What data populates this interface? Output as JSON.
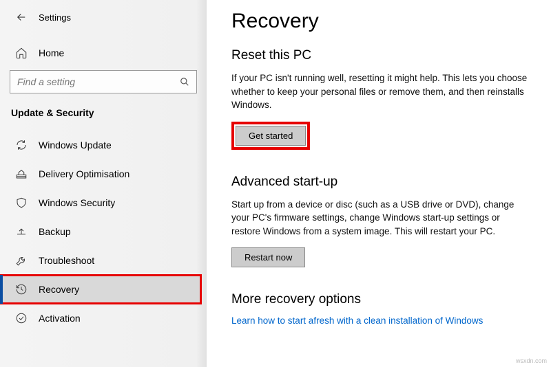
{
  "header": {
    "app_title": "Settings"
  },
  "sidebar": {
    "home_label": "Home",
    "search_placeholder": "Find a setting",
    "category_label": "Update & Security",
    "items": [
      {
        "label": "Windows Update"
      },
      {
        "label": "Delivery Optimisation"
      },
      {
        "label": "Windows Security"
      },
      {
        "label": "Backup"
      },
      {
        "label": "Troubleshoot"
      },
      {
        "label": "Recovery"
      },
      {
        "label": "Activation"
      }
    ]
  },
  "main": {
    "page_title": "Recovery",
    "reset": {
      "title": "Reset this PC",
      "desc": "If your PC isn't running well, resetting it might help. This lets you choose whether to keep your personal files or remove them, and then reinstalls Windows.",
      "button": "Get started"
    },
    "advanced": {
      "title": "Advanced start-up",
      "desc": "Start up from a device or disc (such as a USB drive or DVD), change your PC's firmware settings, change Windows start-up settings or restore Windows from a system image. This will restart your PC.",
      "button": "Restart now"
    },
    "more": {
      "title": "More recovery options",
      "link": "Learn how to start afresh with a clean installation of Windows"
    }
  },
  "watermark": "wsxdn.com"
}
